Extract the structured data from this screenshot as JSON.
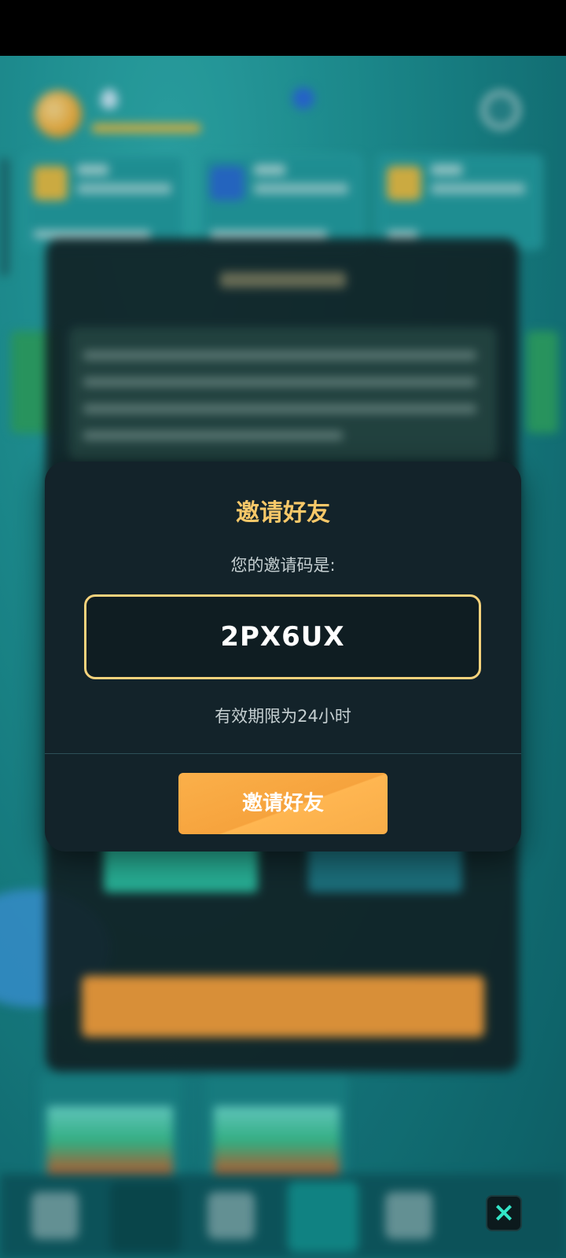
{
  "modal": {
    "title": "邀请好友",
    "subtitle": "您的邀请码是:",
    "code": "2PX6UX",
    "validity": "有效期限为24小时",
    "button_label": "邀请好友"
  },
  "background": {
    "close_icon": "×"
  },
  "colors": {
    "title_gold": "#f7c869",
    "code_border": "#f6d27c",
    "button_orange": "#f6a33d",
    "modal_bg": "#13232a",
    "close_icon_teal": "#33e6c8"
  },
  "icons": [
    "coin-icon",
    "drop-icon",
    "gear-icon",
    "close-icon"
  ]
}
